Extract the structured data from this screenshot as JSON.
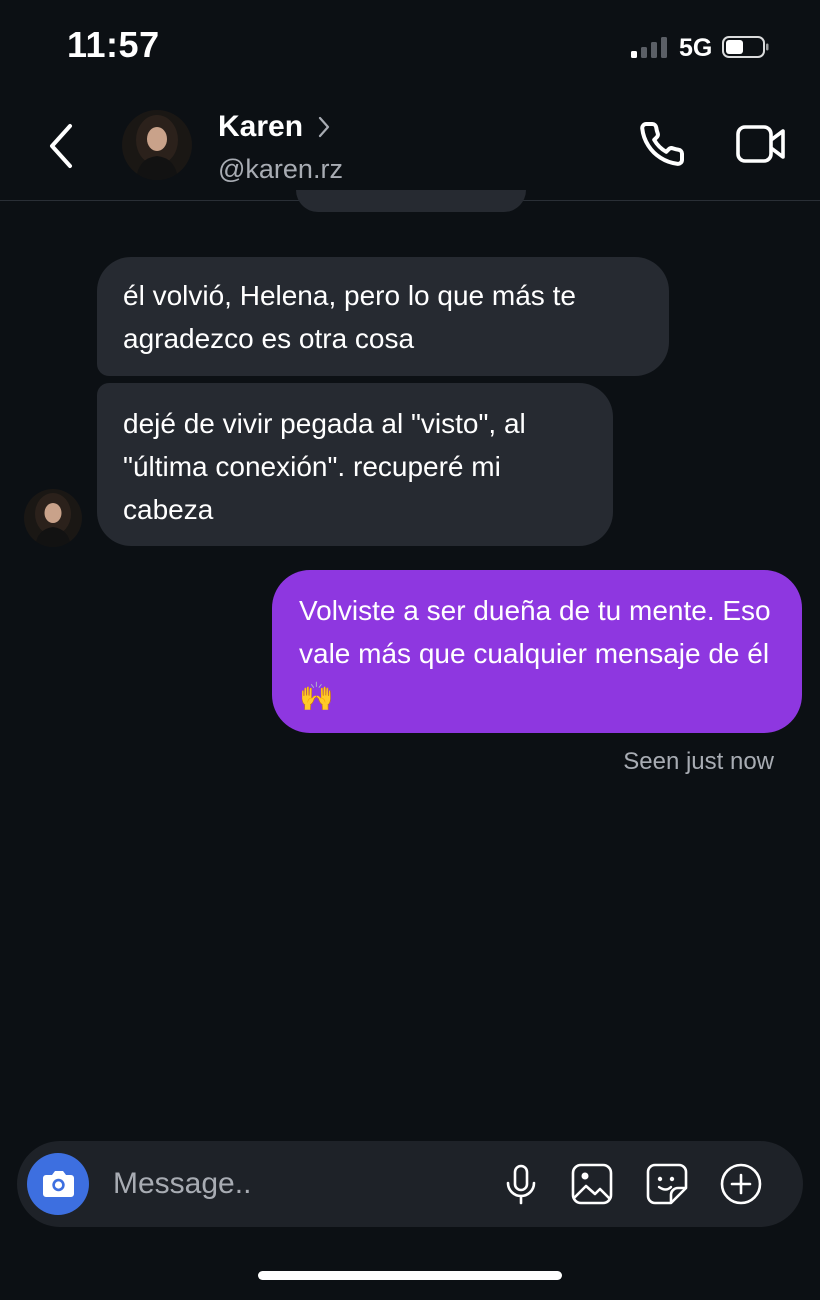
{
  "status_bar": {
    "time": "11:57",
    "network": "5G",
    "signal_bars_active": 1,
    "signal_bars_total": 4,
    "battery_level": 0.45
  },
  "header": {
    "back_icon": "chevron-left-icon",
    "contact_name": "Karen",
    "contact_handle": "@karen.rz",
    "call_icon": "phone-icon",
    "video_icon": "video-camera-icon"
  },
  "messages": [
    {
      "direction": "incoming",
      "text": "él volvió, Helena, pero lo que más te agradezco es otra cosa"
    },
    {
      "direction": "incoming",
      "text": "dejé de vivir pegada al \"visto\", al \"última conexión\". recuperé mi cabeza"
    },
    {
      "direction": "outgoing",
      "text": "Volviste a ser dueña de tu mente. Eso vale más que cualquier mensaje de él 🙌"
    }
  ],
  "seen_status": "Seen just now",
  "composer": {
    "placeholder": "Message..",
    "icons": [
      "camera-icon",
      "microphone-icon",
      "gallery-icon",
      "sticker-icon",
      "plus-circle-icon"
    ]
  },
  "colors": {
    "background": "#0c1014",
    "incoming_bubble": "#262a31",
    "outgoing_bubble": "#8e37e0",
    "camera_button": "#3d6fe0",
    "secondary_text": "#a8acb3"
  }
}
